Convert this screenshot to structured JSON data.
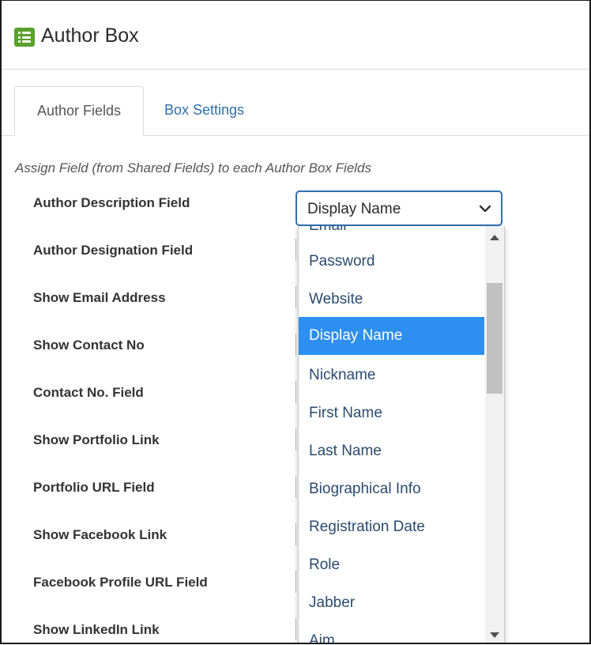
{
  "header": {
    "title": "Author Box",
    "icon": "list-icon",
    "icon_color": "#5aa02c"
  },
  "tabs": [
    {
      "label": "Author Fields",
      "active": true
    },
    {
      "label": "Box Settings",
      "active": false
    }
  ],
  "intro": "Assign Field (from Shared Fields) to each Author Box Fields",
  "fields": [
    "Author Description Field",
    "Author Designation Field",
    "Show Email Address",
    "Show Contact No",
    "Contact No. Field",
    "Show Portfolio Link",
    "Portfolio URL Field",
    "Show Facebook Link",
    "Facebook Profile URL Field",
    "Show LinkedIn Link"
  ],
  "select": {
    "value": "Display Name"
  },
  "dropdown": {
    "partial_top": "Email",
    "options": [
      "Password",
      "Website",
      "Display Name",
      "Nickname",
      "First Name",
      "Last Name",
      "Biographical Info",
      "Registration Date",
      "Role",
      "Jabber",
      "Aim"
    ],
    "selected": "Display Name"
  },
  "colors": {
    "accent": "#2e6fad",
    "selected_bg": "#2d8ff0",
    "option_text": "#2a4b6e"
  }
}
